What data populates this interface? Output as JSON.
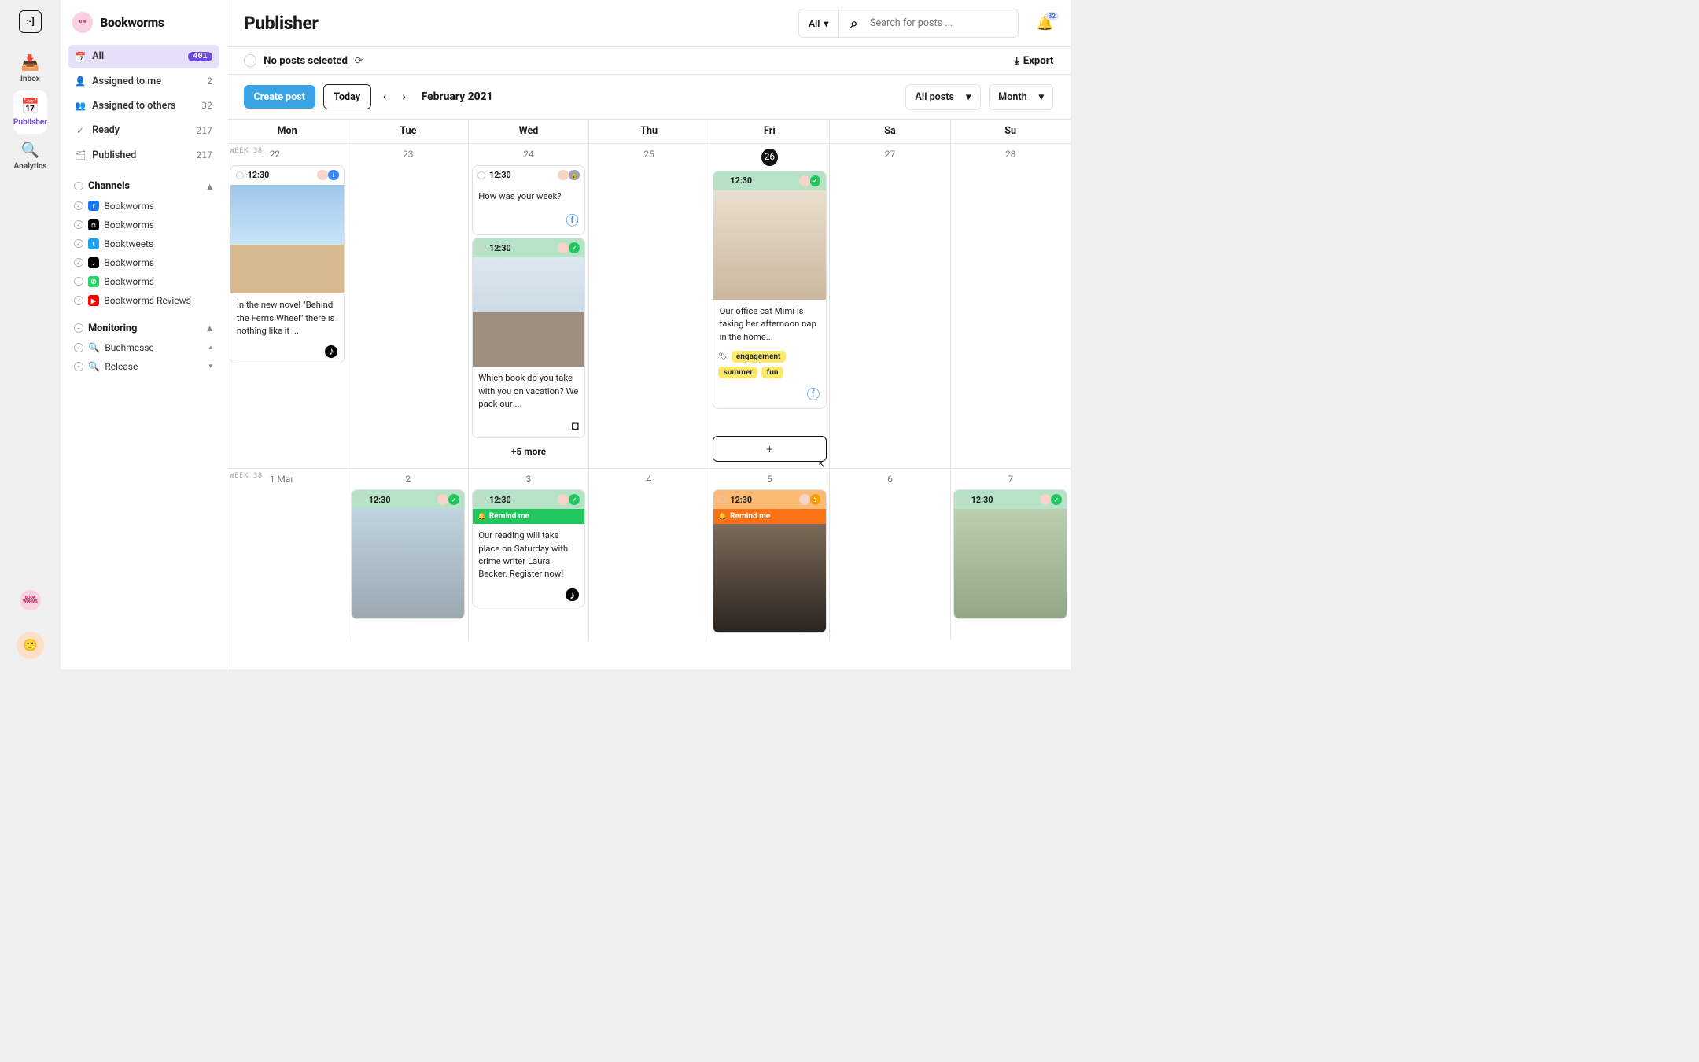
{
  "rail": {
    "items": [
      {
        "icon": "📥",
        "label": "Inbox"
      },
      {
        "icon": "📅",
        "label": "Publisher"
      },
      {
        "icon": "🔍",
        "label": "Analytics"
      }
    ],
    "activeIndex": 1,
    "orgAbbrev": "BOOK\nWORMS"
  },
  "workspace": {
    "name": "Bookworms"
  },
  "folders": [
    {
      "icon": "📅",
      "label": "All",
      "count": "401",
      "active": true,
      "badge": true
    },
    {
      "icon": "👤",
      "label": "Assigned to me",
      "count": "2"
    },
    {
      "icon": "👥",
      "label": "Assigned to others",
      "count": "32"
    },
    {
      "icon": "✓",
      "label": "Ready",
      "count": "217"
    },
    {
      "icon": "🗂",
      "label": "Published",
      "count": "217"
    }
  ],
  "channelsHeader": "Channels",
  "channels": [
    {
      "name": "Bookworms",
      "net": "fb",
      "checked": true
    },
    {
      "name": "Bookworms",
      "net": "ig",
      "checked": true
    },
    {
      "name": "Booktweets",
      "net": "tw",
      "checked": true
    },
    {
      "name": "Bookworms",
      "net": "tt",
      "checked": true
    },
    {
      "name": "Bookworms",
      "net": "wa",
      "checked": false
    },
    {
      "name": "Bookworms Reviews",
      "net": "yt",
      "checked": true
    }
  ],
  "monitoringHeader": "Monitoring",
  "monitoring": [
    {
      "name": "Buchmesse",
      "minus": false,
      "chev": "▴"
    },
    {
      "name": "Release",
      "minus": true,
      "chev": "▾"
    }
  ],
  "header": {
    "title": "Publisher",
    "searchScope": "All",
    "searchPlaceholder": "Search for posts ...",
    "notifications": "32"
  },
  "selection": {
    "text": "No posts selected",
    "exportLabel": "Export"
  },
  "toolbar": {
    "create": "Create post",
    "today": "Today",
    "date": "February 2021",
    "filter": "All posts",
    "view": "Month"
  },
  "dayHeaders": [
    "Mon",
    "Tue",
    "Wed",
    "Thu",
    "Fri",
    "Sa",
    "Su"
  ],
  "weeks": [
    {
      "label": "Week 38",
      "days": [
        {
          "num": "22",
          "cards": [
            {
              "time": "12:30",
              "status": "info",
              "image": "ferris",
              "text": "In the new novel \"Behind the Ferris Wheel\" there is nothing like it ...",
              "footerIcon": "tt"
            }
          ]
        },
        {
          "num": "23"
        },
        {
          "num": "24",
          "cards": [
            {
              "time": "12:30",
              "status": "lock",
              "text": "How was your week?",
              "footerIcon": "fb-blue"
            },
            {
              "time": "12:30",
              "status": "ok",
              "color": "green",
              "image": "road",
              "text": "Which book do you take with you on vacation? We pack our ...",
              "footerIcon": "ig"
            }
          ],
          "more": "+5 more"
        },
        {
          "num": "25"
        },
        {
          "num": "26",
          "today": true,
          "cards": [
            {
              "time": "12:30",
              "status": "ok",
              "color": "green",
              "image": "cat",
              "text": "Our office cat Mimi is taking her afternoon nap in the home...",
              "tags": [
                "engagement",
                "summer",
                "fun"
              ],
              "footerIcon": "fb-blue"
            }
          ],
          "addSlot": true
        },
        {
          "num": "27"
        },
        {
          "num": "28"
        }
      ]
    },
    {
      "label": "Week 38",
      "days": [
        {
          "num": "1 Mar"
        },
        {
          "num": "2",
          "cards": [
            {
              "time": "12:30",
              "status": "ok",
              "color": "green",
              "image": "bridge"
            }
          ]
        },
        {
          "num": "3",
          "cards": [
            {
              "time": "12:30",
              "status": "ok",
              "color": "green",
              "remind": "Remind me",
              "remindColor": "g",
              "text": "Our reading will take place on Saturday with crime writer Laura Becker. Register now!",
              "footerIcon": "tt"
            }
          ]
        },
        {
          "num": "4"
        },
        {
          "num": "5",
          "cards": [
            {
              "time": "12:30",
              "status": "q",
              "color": "orange",
              "remind": "Remind me",
              "remindColor": "o",
              "image": "guitar"
            }
          ]
        },
        {
          "num": "6"
        },
        {
          "num": "7",
          "cards": [
            {
              "time": "12:30",
              "status": "ok",
              "color": "green",
              "image": "tennis"
            }
          ]
        }
      ]
    }
  ]
}
